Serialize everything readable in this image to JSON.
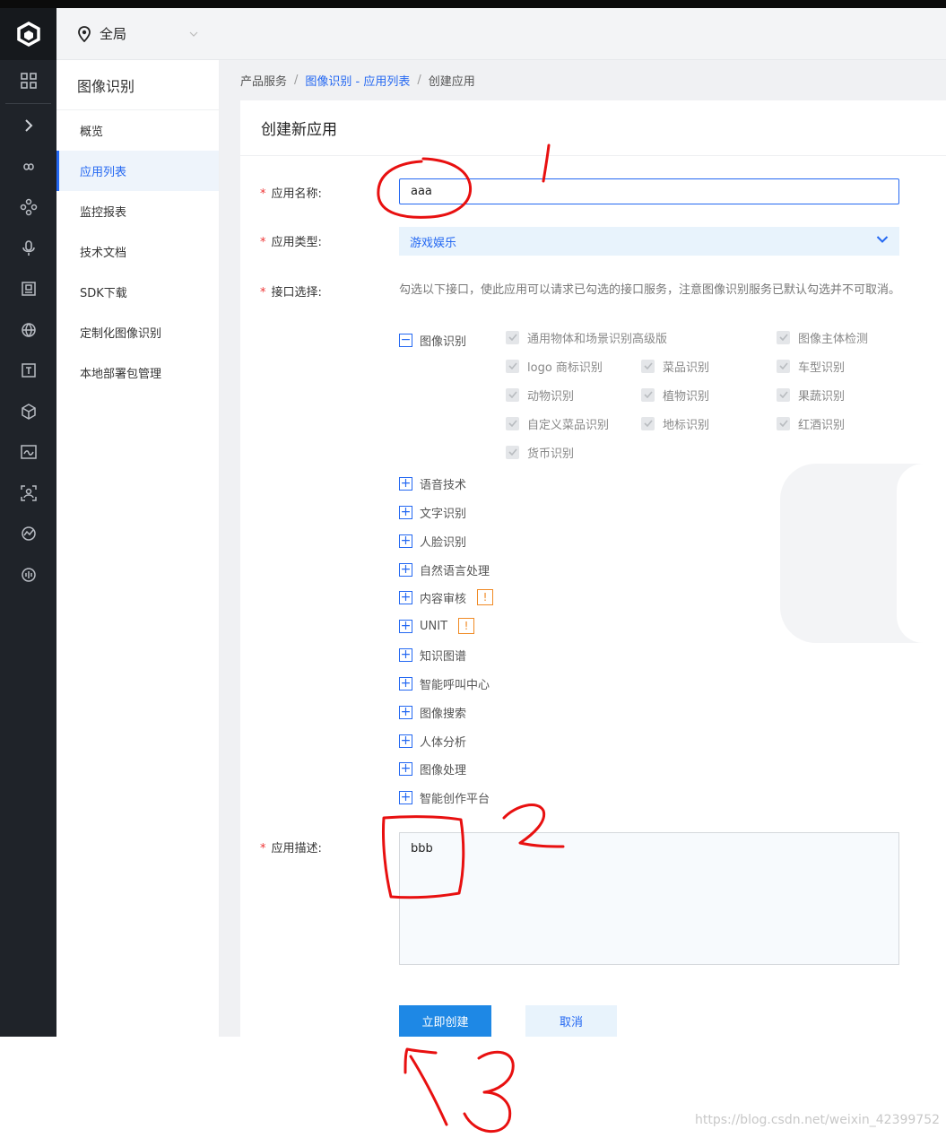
{
  "header": {
    "region": "全局"
  },
  "sidebar": {
    "title": "图像识别",
    "items": [
      {
        "label": "概览",
        "active": false
      },
      {
        "label": "应用列表",
        "active": true
      },
      {
        "label": "监控报表",
        "active": false
      },
      {
        "label": "技术文档",
        "active": false
      },
      {
        "label": "SDK下载",
        "active": false
      },
      {
        "label": "定制化图像识别",
        "active": false
      },
      {
        "label": "本地部署包管理",
        "active": false
      }
    ]
  },
  "breadcrumb": {
    "root": "产品服务",
    "sep": "/",
    "link": "图像识别 - 应用列表",
    "current": "创建应用"
  },
  "form": {
    "title": "创建新应用",
    "required_mark": "*",
    "name_label": "应用名称:",
    "name_value": "aaa",
    "type_label": "应用类型:",
    "type_value": "游戏娱乐",
    "api_label": "接口选择:",
    "api_desc": "勾选以下接口，使此应用可以请求已勾选的接口服务，注意图像识别服务已默认勾选并不可取消。",
    "image_group": {
      "label": "图像识别",
      "expanded_symbol": "−",
      "items": [
        "通用物体和场景识别高级版",
        "图像主体检测",
        "logo 商标识别",
        "菜品识别",
        "车型识别",
        "动物识别",
        "植物识别",
        "果蔬识别",
        "自定义菜品识别",
        "地标识别",
        "红酒识别",
        "货币识别"
      ]
    },
    "collapsed_symbol": "+",
    "warn_symbol": "!",
    "other_groups": [
      {
        "label": "语音技术",
        "warn": false
      },
      {
        "label": "文字识别",
        "warn": false
      },
      {
        "label": "人脸识别",
        "warn": false
      },
      {
        "label": "自然语言处理",
        "warn": false
      },
      {
        "label": "内容审核",
        "warn": true
      },
      {
        "label": "UNIT",
        "warn": true
      },
      {
        "label": "知识图谱",
        "warn": false
      },
      {
        "label": "智能呼叫中心",
        "warn": false
      },
      {
        "label": "图像搜索",
        "warn": false
      },
      {
        "label": "人体分析",
        "warn": false
      },
      {
        "label": "图像处理",
        "warn": false
      },
      {
        "label": "智能创作平台",
        "warn": false
      }
    ],
    "desc_label": "应用描述:",
    "desc_value": "bbb",
    "create_button": "立即创建",
    "cancel_button": "取消"
  },
  "watermark": "https://blog.csdn.net/weixin_42399752",
  "colors": {
    "accent": "#2468f2",
    "primary_button": "#1e88e5",
    "rail": "#1f2329",
    "annotation": "#e81010"
  }
}
